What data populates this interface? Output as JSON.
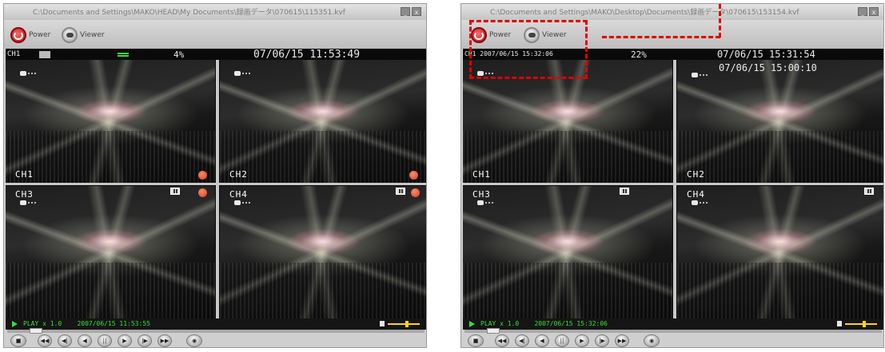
{
  "left_window": {
    "title": "C:\\Documents and Settings\\MAKO\\HEAD\\My Documents\\録画データ\\070615\\115351.kvf",
    "toolbar": {
      "power_label": "Power",
      "viewer_label": "Viewer"
    },
    "header": {
      "channel": "CH1",
      "percent": "4%",
      "datetime": "07/06/15 11:53:49"
    },
    "channels": [
      "CH1",
      "CH2",
      "CH3",
      "CH4"
    ],
    "status": {
      "mode": "PLAY",
      "speed": "x 1.0",
      "datetime": "2007/06/15 11:53:55"
    },
    "volume_level": 0.6
  },
  "right_window": {
    "title": "C:\\Documents and Settings\\MAKO\\Desktop\\Documents\\録画データ\\070615\\153154.kvf",
    "toolbar": {
      "power_label": "Power",
      "viewer_label": "Viewer"
    },
    "header": {
      "channel_datetime": "CH1 2007/06/15 15:32:06",
      "percent": "22%",
      "datetime_1": "07/06/15 15:31:54",
      "datetime_2": "07/06/15 15:00:10"
    },
    "channels": [
      "CH1",
      "CH2",
      "CH3",
      "CH4"
    ],
    "status": {
      "mode": "PLAY",
      "speed": "x 1.0",
      "datetime": "2007/06/15 15:32:06"
    },
    "volume_level": 0.6
  },
  "window_buttons": {
    "minimize": "_",
    "close": "x"
  },
  "controls": [
    "stop",
    "rewind",
    "prev",
    "back",
    "pause",
    "play",
    "next",
    "forward",
    "snapshot"
  ],
  "colors": {
    "status_green": "#38e03a",
    "annotation_red": "#e00000",
    "rec_orange": "#d2401a",
    "volume_yellow": "#ffd21e"
  }
}
